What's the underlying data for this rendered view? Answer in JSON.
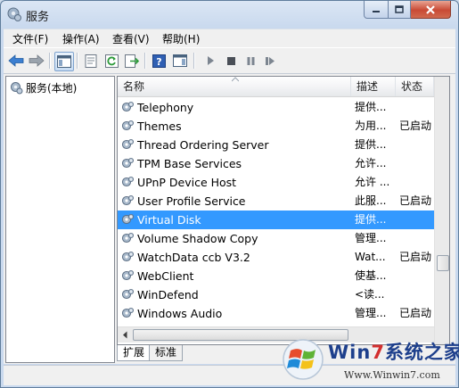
{
  "window": {
    "title": "服务"
  },
  "menubar": {
    "items": [
      "文件(F)",
      "操作(A)",
      "查看(V)",
      "帮助(H)"
    ]
  },
  "tree": {
    "root_label": "服务(本地)"
  },
  "list": {
    "columns": {
      "name": "名称",
      "description": "描述",
      "status": "状态"
    },
    "rows": [
      {
        "name": "Telephony",
        "description": "提供...",
        "status": ""
      },
      {
        "name": "Themes",
        "description": "为用...",
        "status": "已启动"
      },
      {
        "name": "Thread Ordering Server",
        "description": "提供...",
        "status": ""
      },
      {
        "name": "TPM Base Services",
        "description": "允许...",
        "status": ""
      },
      {
        "name": "UPnP Device Host",
        "description": "允许 ...",
        "status": ""
      },
      {
        "name": "User Profile Service",
        "description": "此服...",
        "status": "已启动"
      },
      {
        "name": "Virtual Disk",
        "description": "提供...",
        "status": "",
        "selected": true
      },
      {
        "name": "Volume Shadow Copy",
        "description": "管理...",
        "status": ""
      },
      {
        "name": "WatchData ccb V3.2",
        "description": "Wat...",
        "status": "已启动"
      },
      {
        "name": "WebClient",
        "description": "使基...",
        "status": ""
      },
      {
        "name": "WinDefend",
        "description": "<读...",
        "status": ""
      },
      {
        "name": "Windows Audio",
        "description": "管理...",
        "status": "已启动"
      }
    ]
  },
  "tabs": {
    "extended": "扩展",
    "standard": "标准"
  },
  "watermark": {
    "brand_win": "Win",
    "brand_seven": "7",
    "brand_rest": "系统之家",
    "url": "Www.Winwin7.com"
  },
  "colors": {
    "selection": "#3399ff",
    "close_button": "#c94a35",
    "watermark_blue": "#1d3f8c",
    "watermark_red": "#d32f2f"
  },
  "icons": {
    "service": "gear-icon",
    "back": "back-arrow-icon",
    "forward": "forward-arrow-icon",
    "help": "help-icon",
    "play": "play-icon",
    "stop": "stop-icon",
    "pause": "pause-icon",
    "restart": "restart-icon"
  }
}
